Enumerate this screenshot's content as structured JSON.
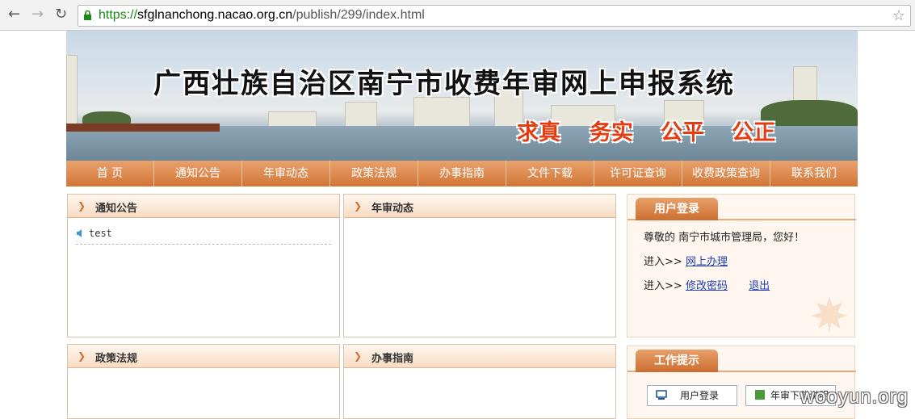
{
  "browser": {
    "url_scheme": "https://",
    "url_host": "sfglnanchong.nacao.org.cn",
    "url_path": "/publish/299/index.html"
  },
  "banner": {
    "title": "广西壮族自治区南宁市收费年审网上申报系统",
    "slogans": [
      "求真",
      "务实",
      "公平",
      "公正"
    ]
  },
  "nav": {
    "items": [
      "首 页",
      "通知公告",
      "年审动态",
      "政策法规",
      "办事指南",
      "文件下载",
      "许可证查询",
      "收费政策查询",
      "联系我们"
    ]
  },
  "panels": {
    "notice": {
      "title": "通知公告",
      "items": [
        "test"
      ]
    },
    "annual": {
      "title": "年审动态"
    },
    "policy": {
      "title": "政策法规"
    },
    "guide": {
      "title": "办事指南"
    }
  },
  "login": {
    "title": "用户登录",
    "greeting_prefix": "尊敬的",
    "greeting_user": "南宁市城市管理局，您好！",
    "enter_label": "进入>>",
    "online_link": "网上办理",
    "change_pw_link": "修改密码",
    "logout_link": "退出"
  },
  "tips": {
    "title": "工作提示",
    "login_btn": "用户登录",
    "download_btn": "年审下载说明"
  },
  "watermark": "wooyun.org",
  "colors": {
    "accent": "#d17636",
    "link": "#1f3fb0",
    "slogan": "#e43b10"
  }
}
